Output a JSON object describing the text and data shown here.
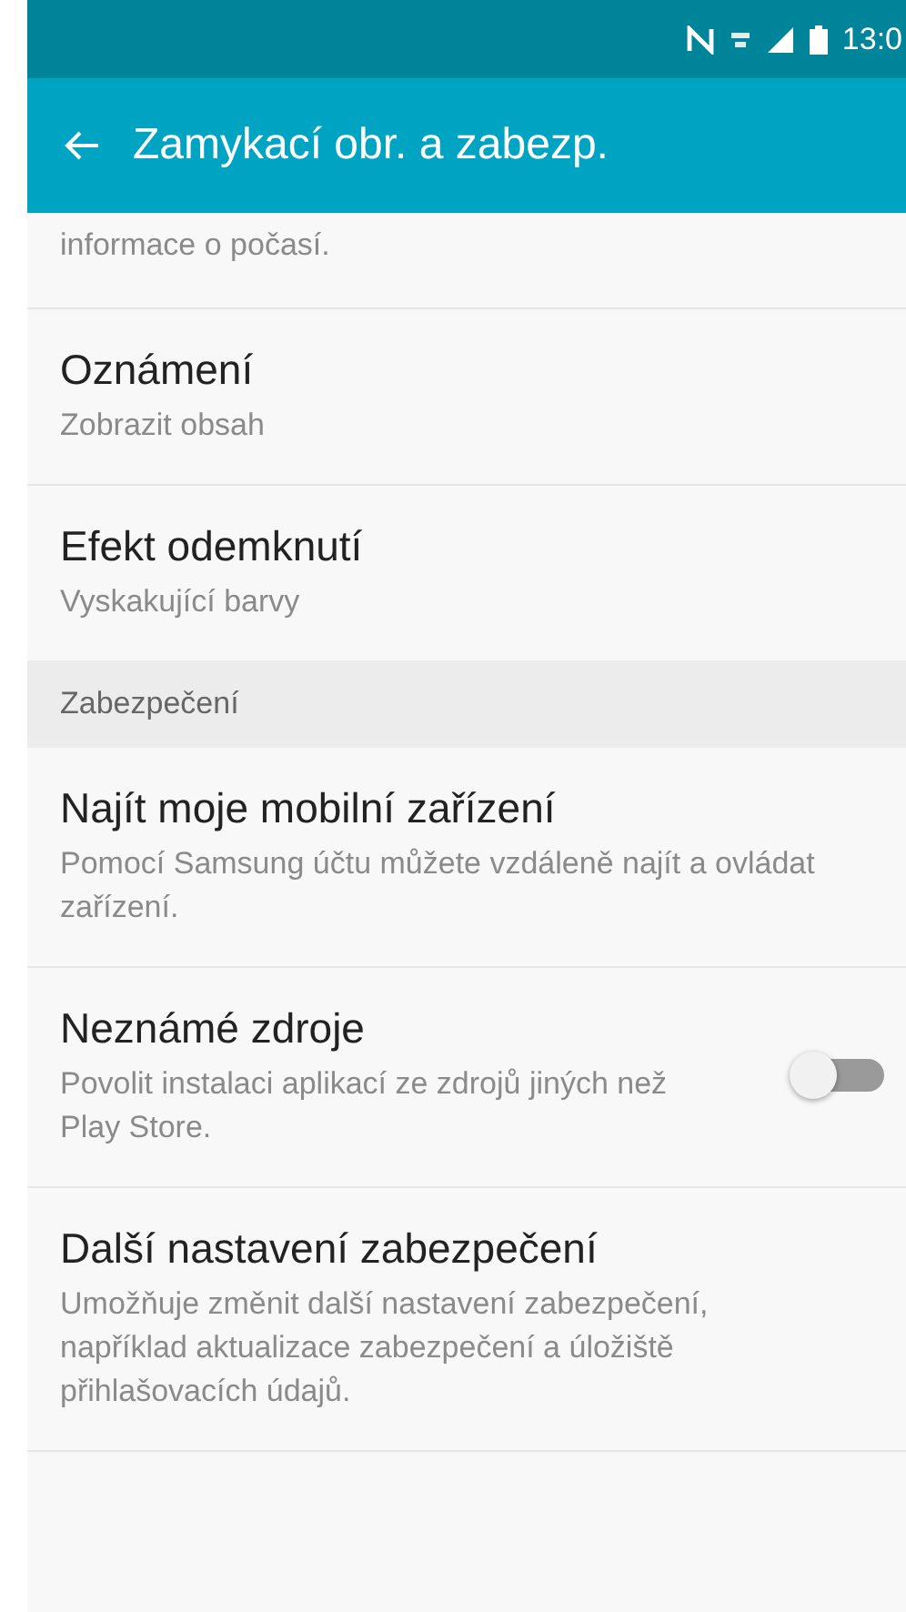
{
  "status_bar": {
    "time": "13:0"
  },
  "app_bar": {
    "title": "Zamykací obr. a zabezp."
  },
  "items": [
    {
      "kind": "continuation",
      "summary": "informace o počasí."
    },
    {
      "kind": "setting",
      "title": "Oznámení",
      "summary": "Zobrazit obsah"
    },
    {
      "kind": "setting",
      "title": "Efekt odemknutí",
      "summary": "Vyskakující barvy"
    },
    {
      "kind": "header",
      "title": "Zabezpečení"
    },
    {
      "kind": "setting",
      "title": "Najít moje mobilní zařízení",
      "summary": "Pomocí Samsung účtu můžete vzdáleně najít a ovládat zařízení."
    },
    {
      "kind": "switch",
      "title": "Neznámé zdroje",
      "summary": "Povolit instalaci aplikací ze zdrojů jiných než Play Store.",
      "on": false
    },
    {
      "kind": "setting",
      "title": "Další nastavení zabezpečení",
      "summary": "Umožňuje změnit další nastavení zabezpečení, například aktualizace zabezpečení a úložiště přihlašovacích údajů."
    }
  ]
}
